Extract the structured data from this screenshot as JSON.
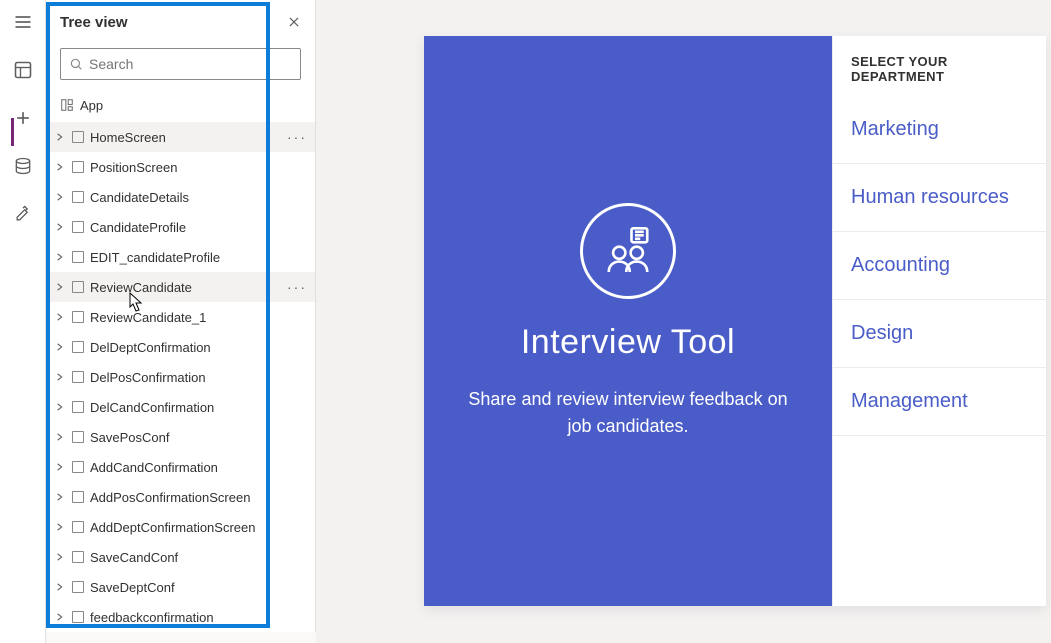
{
  "tree": {
    "title": "Tree view",
    "search_placeholder": "Search",
    "app_label": "App",
    "items": [
      {
        "label": "HomeScreen",
        "selected": true,
        "more": true
      },
      {
        "label": "PositionScreen"
      },
      {
        "label": "CandidateDetails"
      },
      {
        "label": "CandidateProfile"
      },
      {
        "label": "EDIT_candidateProfile"
      },
      {
        "label": "ReviewCandidate",
        "hover": true,
        "more": true
      },
      {
        "label": "ReviewCandidate_1"
      },
      {
        "label": "DelDeptConfirmation"
      },
      {
        "label": "DelPosConfirmation"
      },
      {
        "label": "DelCandConfirmation"
      },
      {
        "label": "SavePosConf"
      },
      {
        "label": "AddCandConfirmation"
      },
      {
        "label": "AddPosConfirmationScreen"
      },
      {
        "label": "AddDeptConfirmationScreen"
      },
      {
        "label": "SaveCandConf"
      },
      {
        "label": "SaveDeptConf"
      },
      {
        "label": "feedbackconfirmation"
      }
    ]
  },
  "preview": {
    "title": "Interview Tool",
    "subtitle": "Share and review interview feedback on job candidates.",
    "dept_header": "SELECT YOUR DEPARTMENT",
    "departments": [
      "Marketing",
      "Human resources",
      "Accounting",
      "Design",
      "Management"
    ]
  },
  "colors": {
    "brand": "#4a5cc7",
    "highlight": "#0c7dd9"
  }
}
